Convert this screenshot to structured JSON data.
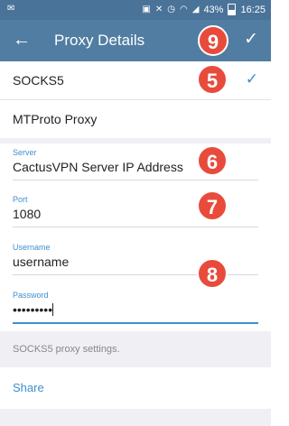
{
  "statusbar": {
    "left_icon": "✉",
    "battery": "43%",
    "time": "16:25",
    "icons": [
      "image-icon",
      "mute-icon",
      "alarm-icon",
      "wifi-icon",
      "signal-icon"
    ]
  },
  "appbar": {
    "title": "Proxy Details",
    "back_icon": "←",
    "done_icon": "✓"
  },
  "proxy_types": [
    {
      "label": "SOCKS5",
      "selected": true
    },
    {
      "label": "MTProto Proxy",
      "selected": false
    }
  ],
  "check_icon": "✓",
  "fields": {
    "server": {
      "label": "Server",
      "value": "CactusVPN Server IP Address"
    },
    "port": {
      "label": "Port",
      "value": "1080"
    },
    "username": {
      "label": "Username",
      "value": "username"
    },
    "password": {
      "label": "Password",
      "value": "•••••••••"
    }
  },
  "badges": {
    "done": "9",
    "socks": "5",
    "server": "6",
    "port": "7",
    "credentials": "8"
  },
  "info_text": "SOCKS5 proxy settings.",
  "share_label": "Share",
  "colors": {
    "appbar": "#517da2",
    "accent": "#3d8fd1",
    "badge": "#e84b3c"
  }
}
